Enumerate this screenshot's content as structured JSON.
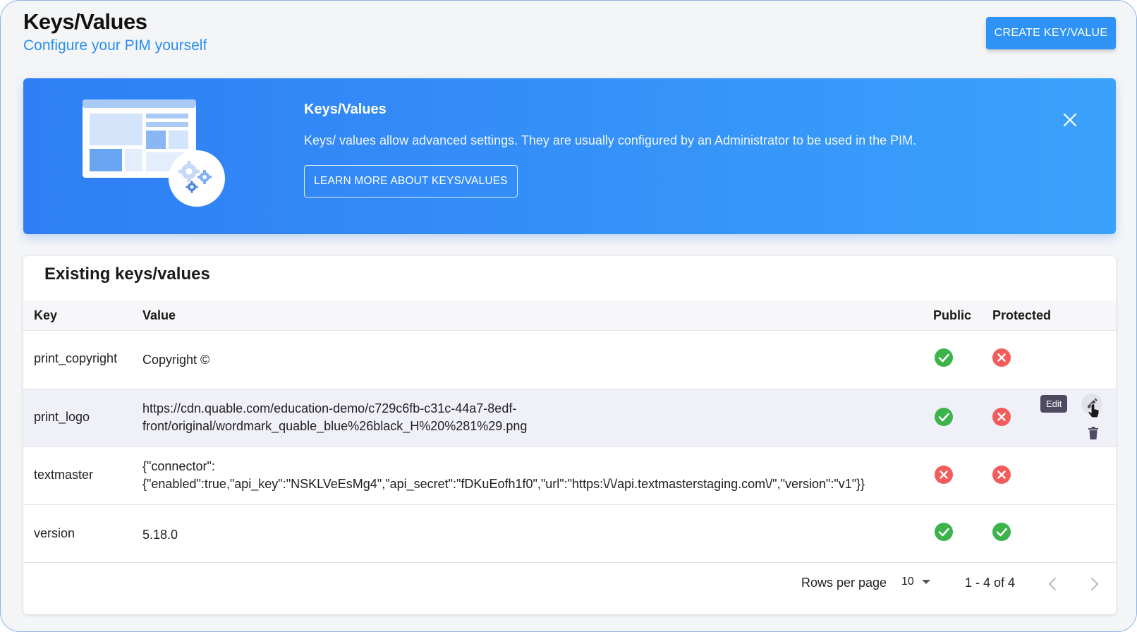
{
  "header": {
    "title": "Keys/Values",
    "subtitle": "Configure your PIM yourself",
    "create_button": "CREATE KEY/VALUE"
  },
  "banner": {
    "title": "Keys/Values",
    "description": "Keys/ values allow advanced settings. They are usually configured by an Administrator to be used in the PIM.",
    "learn_more_button": "LEARN MORE ABOUT KEYS/VALUES",
    "icons": [
      "dashboard-illustration",
      "gears-icon",
      "close-icon"
    ]
  },
  "table": {
    "title": "Existing keys/values",
    "columns": {
      "key": "Key",
      "value": "Value",
      "public": "Public",
      "protected": "Protected"
    },
    "rows": [
      {
        "key": "print_copyright",
        "value_lines": [
          "Copyright ©"
        ],
        "public": true,
        "protected": false
      },
      {
        "key": "print_logo",
        "value_lines": [
          "https://cdn.quable.com/education-demo/c729c6fb-c31c-44a7-8edf-",
          "front/original/wordmark_quable_blue%26black_H%20%281%29.png"
        ],
        "public": true,
        "protected": false
      },
      {
        "key": "textmaster",
        "value_lines": [
          "{\"connector\":",
          "{\"enabled\":true,\"api_key\":\"NSKLVeEsMg4\",\"api_secret\":\"fDKuEofh1f0\",\"url\":\"https:\\/\\/api.textmasterstaging.com\\/\",\"version\":\"v1\"}}"
        ],
        "public": false,
        "protected": false
      },
      {
        "key": "version",
        "value_lines": [
          "5.18.0"
        ],
        "public": true,
        "protected": true
      }
    ],
    "edit_tooltip": "Edit",
    "row_action_icons": [
      "pencil-icon",
      "trash-icon"
    ]
  },
  "pagination": {
    "rows_per_page_label": "Rows per page",
    "rows_per_page_value": "10",
    "range": "1 - 4 of 4"
  },
  "colors": {
    "accent": "#2f93f5",
    "banner_start": "#2f7ef5",
    "banner_end": "#3aa2fb",
    "success": "#3cb44b",
    "danger": "#f25c5c",
    "tooltip": "#4e4a62"
  }
}
